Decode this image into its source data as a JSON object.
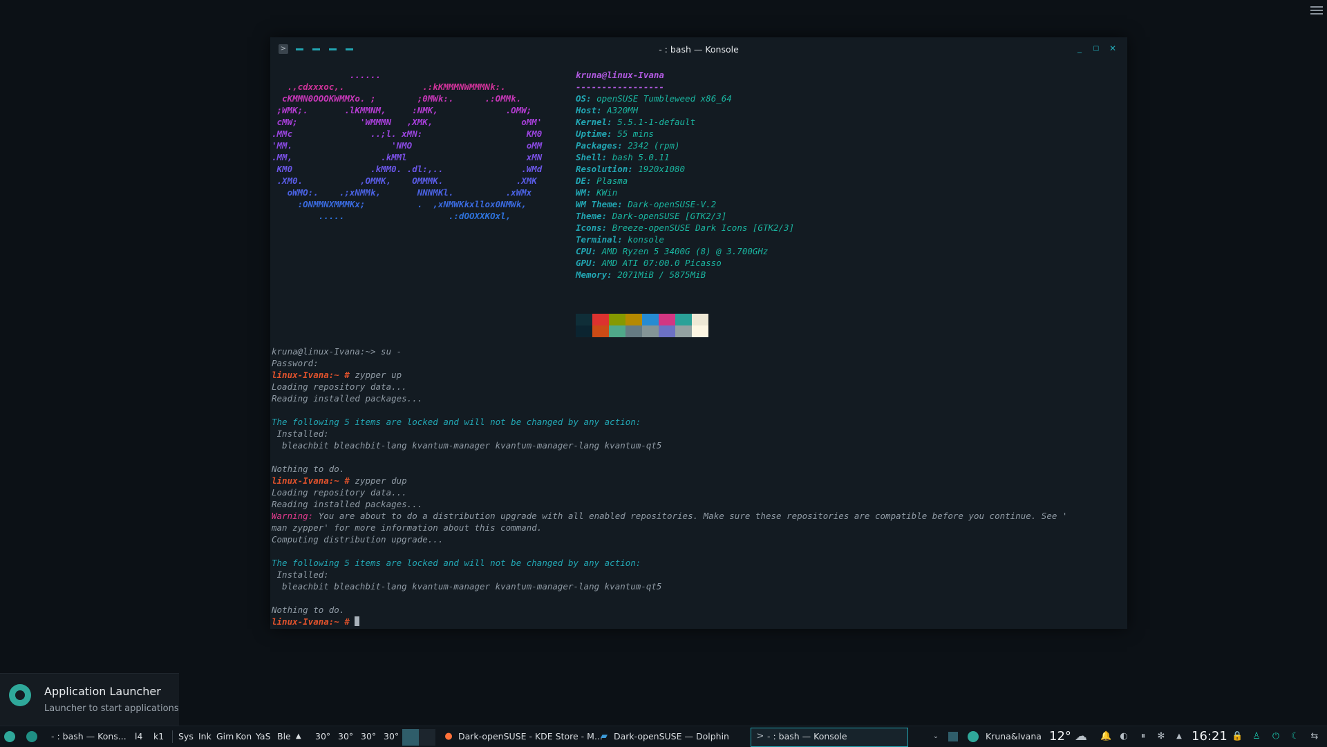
{
  "window": {
    "title": "- : bash — Konsole",
    "prompt_icon": ">"
  },
  "neofetch": {
    "art": [
      {
        "text": "               ......",
        "color": "#b83ad2"
      },
      {
        "text": "   .,cdxxxoc,.               .:kKMMMNWMMMNk:.",
        "color": "#d0339a"
      },
      {
        "text": "  cKMMN0OOOKWMMXo. ;        ;0MWk:.      .:OMMk.",
        "color": "#c737b8"
      },
      {
        "text": " ;WMK;.       .lKMMNM,     :NMK,             .OMW;",
        "color": "#b33cd0"
      },
      {
        "text": " cMW;            'WMMMN   ,XMK,                 oMM'",
        "color": "#a63fd8"
      },
      {
        "text": ".MMc               ..;l. xMN:                    KM0",
        "color": "#9a45de"
      },
      {
        "text": "'MM.                   'NMO                      oMM",
        "color": "#8a4ae2"
      },
      {
        "text": ".MM,                 .kMMl                       xMN",
        "color": "#7a50e4"
      },
      {
        "text": " KM0               .kMM0. .dl:,..               .WMd",
        "color": "#6a56e6"
      },
      {
        "text": " .XM0.           ,OMMK,    OMMMK.              .XMK",
        "color": "#5a5ce6"
      },
      {
        "text": "   oWMO:.    .;xNMMk,       NNNMKl.          .xWMx",
        "color": "#4a62e2"
      },
      {
        "text": "     :ONMMNXMMMKx;          .  ,xNMWKkxllox0NMWk,",
        "color": "#3a6ade"
      },
      {
        "text": "         .....                    .:dOOXXKOxl,",
        "color": "#2e72da"
      }
    ],
    "user": "kruna@linux-Ivana",
    "separator": "-----------------",
    "fields": [
      {
        "key": "OS",
        "value": "openSUSE Tumbleweed x86_64"
      },
      {
        "key": "Host",
        "value": "A320MH"
      },
      {
        "key": "Kernel",
        "value": "5.5.1-1-default"
      },
      {
        "key": "Uptime",
        "value": "55 mins"
      },
      {
        "key": "Packages",
        "value": "2342 (rpm)"
      },
      {
        "key": "Shell",
        "value": "bash 5.0.11"
      },
      {
        "key": "Resolution",
        "value": "1920x1080"
      },
      {
        "key": "DE",
        "value": "Plasma"
      },
      {
        "key": "WM",
        "value": "KWin"
      },
      {
        "key": "WM Theme",
        "value": "Dark-openSUSE-V.2"
      },
      {
        "key": "Theme",
        "value": "Dark-openSUSE [GTK2/3]"
      },
      {
        "key": "Icons",
        "value": "Breeze-openSUSE Dark Icons [GTK2/3]"
      },
      {
        "key": "Terminal",
        "value": "konsole"
      },
      {
        "key": "CPU",
        "value": "AMD Ryzen 5 3400G (8) @ 3.700GHz"
      },
      {
        "key": "GPU",
        "value": "AMD ATI 07:00.0 Picasso"
      },
      {
        "key": "Memory",
        "value": "2071MiB / 5875MiB"
      }
    ],
    "palette_top": [
      "#0f2e38",
      "#dc322f",
      "#859900",
      "#b58900",
      "#268bd2",
      "#d33682",
      "#2aa198",
      "#eee8d5"
    ],
    "palette_bottom": [
      "#0b2430",
      "#cb4b16",
      "#4fa889",
      "#657b83",
      "#839496",
      "#6c71c4",
      "#93a1a1",
      "#fdf6e3"
    ]
  },
  "terminal_lines": [
    {
      "style": "grey",
      "text": "kruna@linux-Ivana:~> su -"
    },
    {
      "style": "grey",
      "text": "Password:"
    },
    {
      "style": "prompt",
      "prompt": "linux-Ivana:~ #",
      "text": " zypper up"
    },
    {
      "style": "grey",
      "text": "Loading repository data..."
    },
    {
      "style": "grey",
      "text": "Reading installed packages..."
    },
    {
      "style": "blank",
      "text": ""
    },
    {
      "style": "cyan",
      "text": "The following 5 items are locked and will not be changed by any action:"
    },
    {
      "style": "grey",
      "text": " Installed:"
    },
    {
      "style": "grey",
      "text": "  bleachbit bleachbit-lang kvantum-manager kvantum-manager-lang kvantum-qt5"
    },
    {
      "style": "blank",
      "text": ""
    },
    {
      "style": "grey",
      "text": "Nothing to do."
    },
    {
      "style": "prompt",
      "prompt": "linux-Ivana:~ #",
      "text": " zypper dup"
    },
    {
      "style": "grey",
      "text": "Loading repository data..."
    },
    {
      "style": "grey",
      "text": "Reading installed packages..."
    },
    {
      "style": "warn",
      "prompt": "Warning:",
      "text": " You are about to do a distribution upgrade with all enabled repositories. Make sure these repositories are compatible before you continue. See '"
    },
    {
      "style": "grey",
      "text": "man zypper' for more information about this command."
    },
    {
      "style": "grey",
      "text": "Computing distribution upgrade..."
    },
    {
      "style": "blank",
      "text": ""
    },
    {
      "style": "cyan",
      "text": "The following 5 items are locked and will not be changed by any action:"
    },
    {
      "style": "grey",
      "text": " Installed:"
    },
    {
      "style": "grey",
      "text": "  bleachbit bleachbit-lang kvantum-manager kvantum-manager-lang kvantum-qt5"
    },
    {
      "style": "blank",
      "text": ""
    },
    {
      "style": "grey",
      "text": "Nothing to do."
    },
    {
      "style": "prompt-cursor",
      "prompt": "linux-Ivana:~ #",
      "text": " "
    }
  ],
  "launcher": {
    "title": "Application Launcher",
    "subtitle": "Launcher to start applications"
  },
  "taskbar": {
    "konsole_short": "- : bash — Kons...",
    "short_items": [
      "l4",
      "k1"
    ],
    "quick_items": [
      "Sys",
      "Ink",
      "Gim",
      "Kon",
      "YaS",
      "Ble"
    ],
    "expand_arrow": "▲",
    "temps": [
      "30°",
      "30°",
      "30°",
      "30°"
    ],
    "tasks": [
      "Dark-openSUSE - KDE Store - M...",
      "Dark-openSUSE — Dolphin",
      "- : bash — Konsole"
    ],
    "user": "Kruna&Ivana",
    "weather_temp": "12°",
    "clock": "16:21"
  }
}
